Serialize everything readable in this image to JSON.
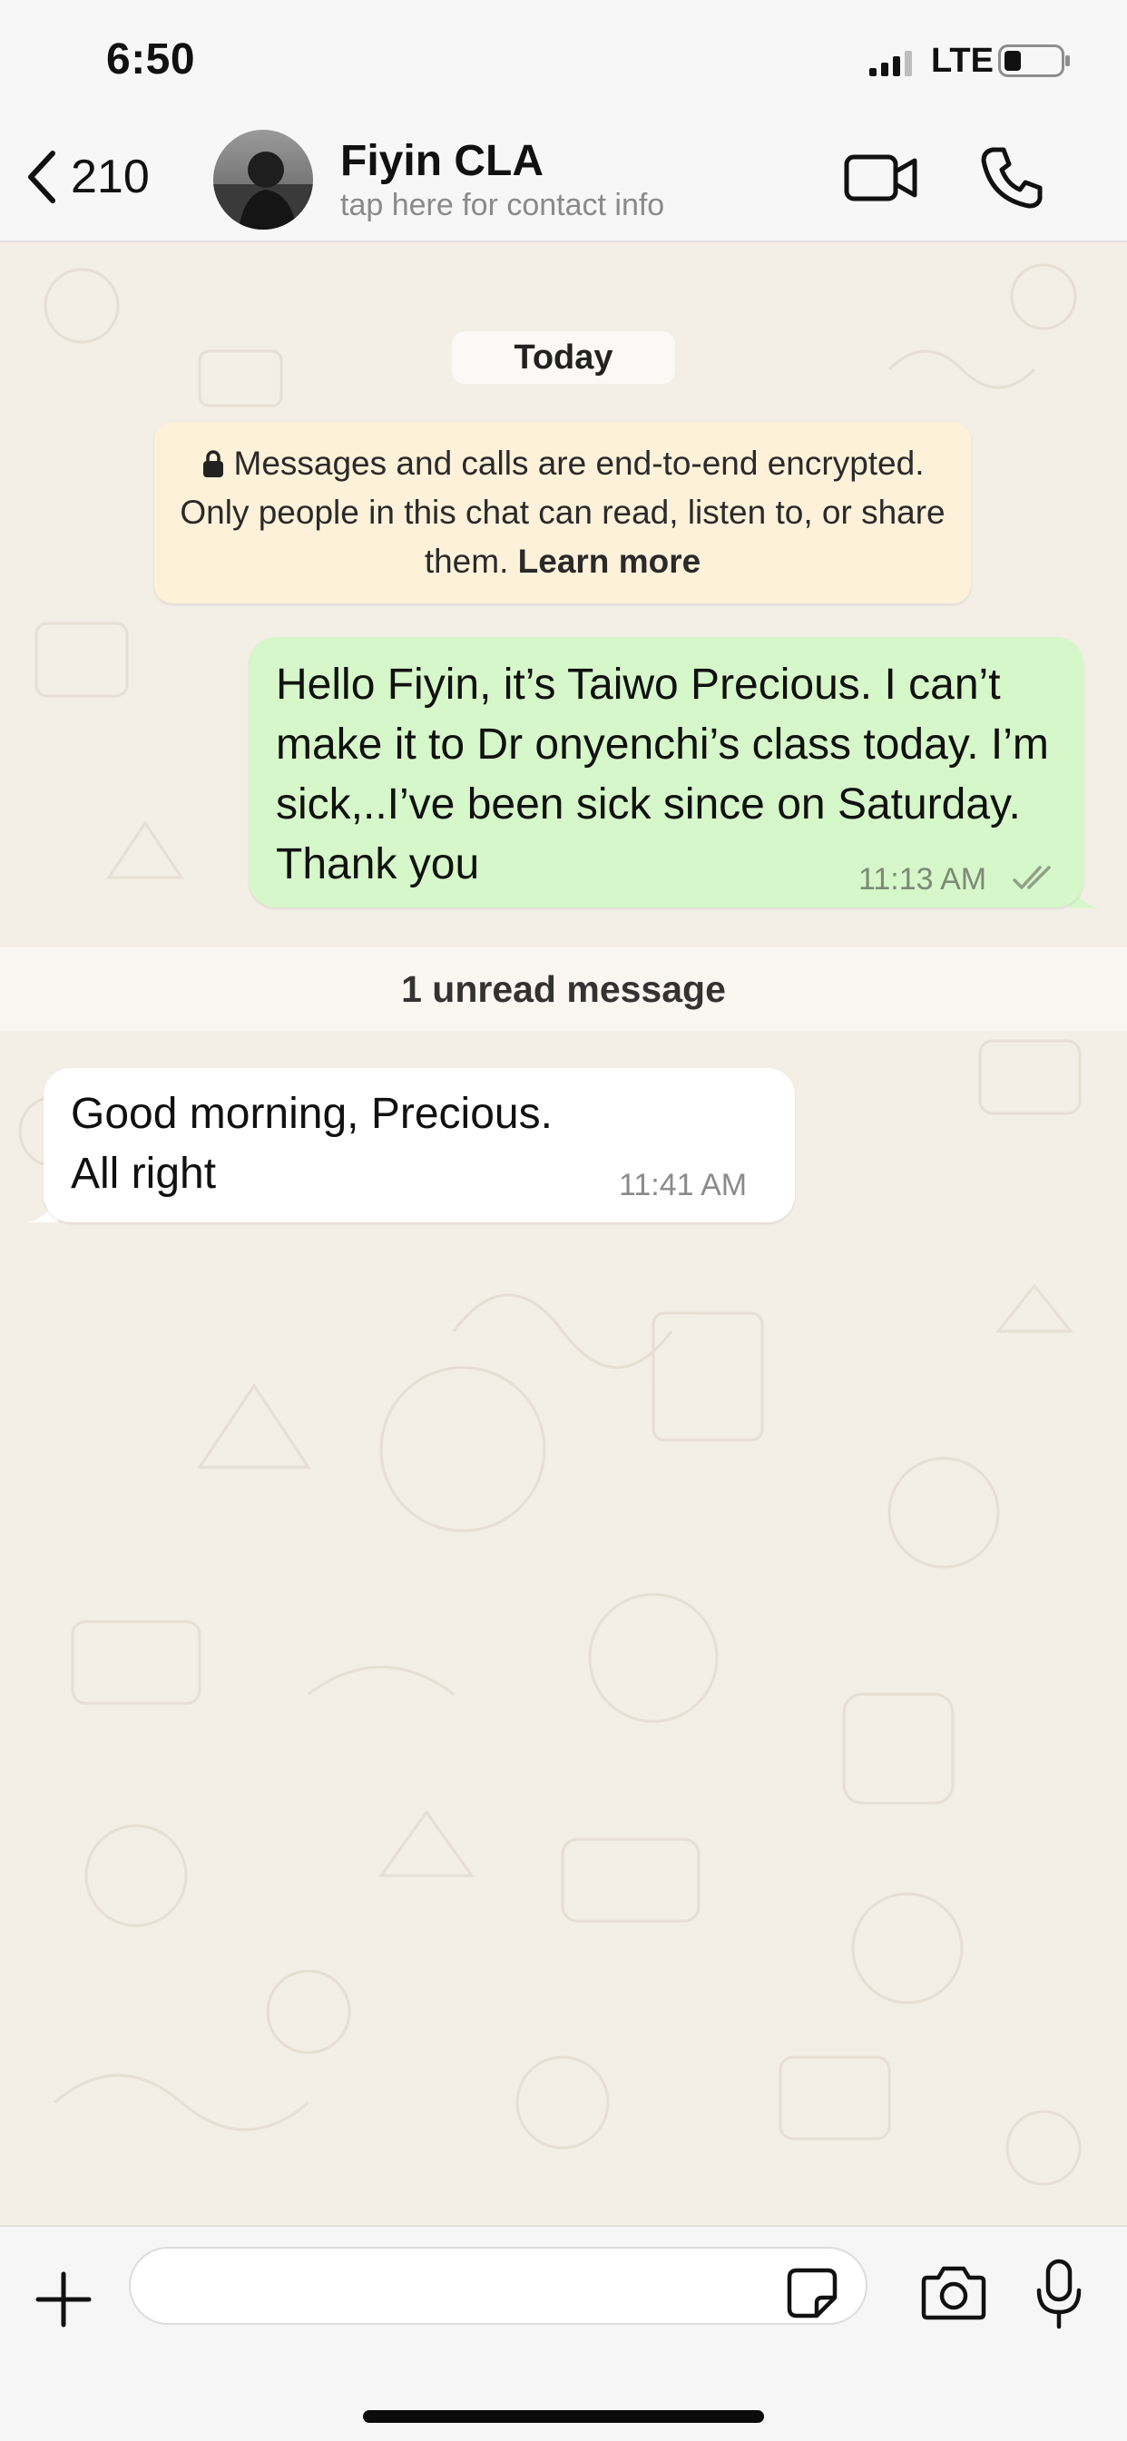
{
  "status_bar": {
    "time": "6:50",
    "network": "LTE",
    "signal_icon": "signal-bars-icon",
    "battery_icon": "battery-icon"
  },
  "header": {
    "back_count": "210",
    "contact_name": "Fiyin CLA",
    "contact_subtitle": "tap here for contact info",
    "icons": [
      "back-chevron-icon",
      "video-call-icon",
      "phone-icon"
    ]
  },
  "chat": {
    "date_separator": "Today",
    "encryption_notice": {
      "text": "Messages and calls are end-to-end encrypted. Only people in this chat can read, listen to, or share them.",
      "link": "Learn more",
      "icon": "lock-icon"
    },
    "messages": [
      {
        "direction": "outgoing",
        "text": "Hello Fiyin, it’s Taiwo Precious. I can’t make it to Dr onyenchi’s class today. I’m sick,..I’ve been sick since on Saturday. Thank you",
        "time": "11:13 AM",
        "status_icon": "double-check-icon"
      },
      {
        "direction": "incoming",
        "lines": [
          "Good morning, Precious.",
          "All right"
        ],
        "time": "11:41 AM"
      }
    ],
    "unread_label": "1 unread message"
  },
  "composer": {
    "input_value": "",
    "icons": [
      "plus-icon",
      "sticker-icon",
      "camera-icon",
      "microphone-icon"
    ]
  },
  "colors": {
    "chat_background": "#f3eee6",
    "outgoing_bubble": "#d6f7c9",
    "incoming_bubble": "#ffffff",
    "encryption_notice": "#fdf1d9"
  }
}
